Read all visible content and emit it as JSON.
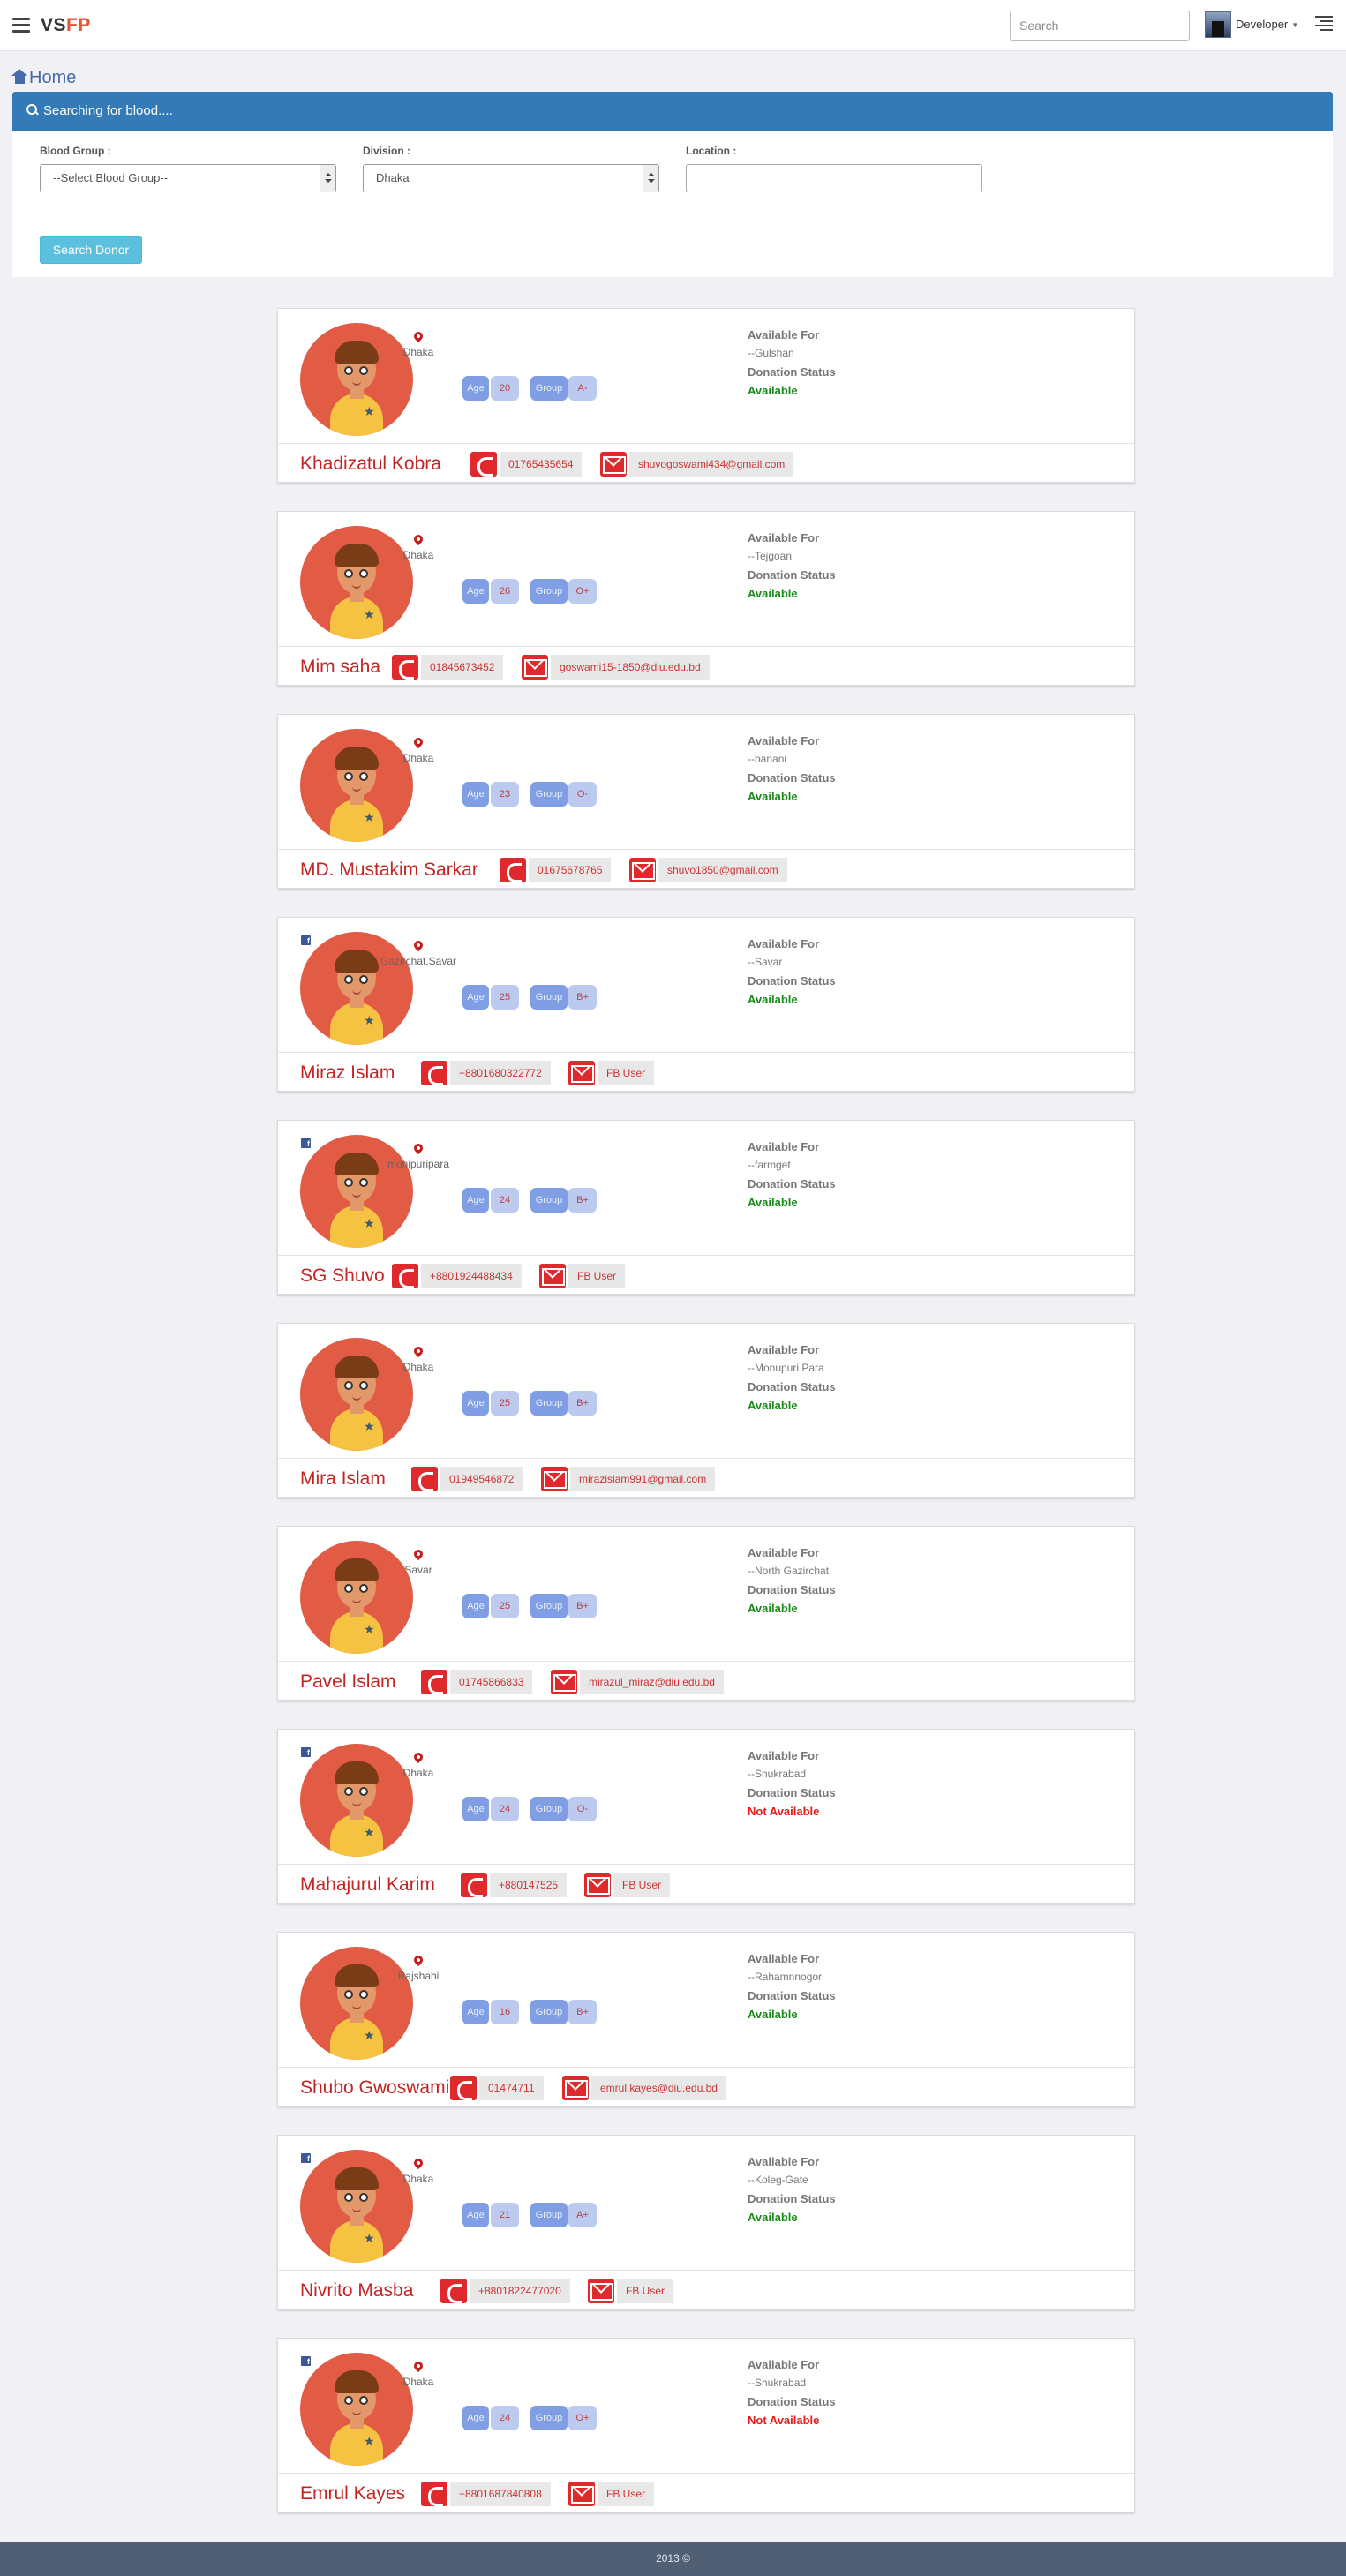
{
  "navbar": {
    "brand_part1": "VS",
    "brand_part2": "FP",
    "search_placeholder": "Search",
    "user_name": "Developer"
  },
  "breadcrumb": {
    "label": "Home"
  },
  "search_panel": {
    "heading": "Searching for blood....",
    "blood_group_label": "Blood Group :",
    "blood_group_value": "--Select Blood Group--",
    "division_label": "Division :",
    "division_value": "Dhaka",
    "location_label": "Location :",
    "location_value": "",
    "button_label": "Search Donor"
  },
  "labels": {
    "age": "Age",
    "group": "Group",
    "available_for": "Available For",
    "donation_status": "Donation Status"
  },
  "colors": {
    "available": "#1a8a1a",
    "not_available": "#e61b1b"
  },
  "donors": [
    {
      "name": "Khadizatul Kobra",
      "location": "Dhaka",
      "age": "20",
      "group": "A-",
      "available_for": "--Gulshan",
      "status": "Available",
      "phone": "01765435654",
      "email": "shuvogoswami434@gmail.com",
      "facebook": false
    },
    {
      "name": "Mim saha",
      "location": "Dhaka",
      "age": "26",
      "group": "O+",
      "available_for": "--Tejgoan",
      "status": "Available",
      "phone": "01845673452",
      "email": "goswami15-1850@diu.edu.bd",
      "facebook": false
    },
    {
      "name": "MD. Mustakim Sarkar",
      "location": "Dhaka",
      "age": "23",
      "group": "O-",
      "available_for": "--banani",
      "status": "Available",
      "phone": "01675678765",
      "email": "shuvo1850@gmail.com",
      "facebook": false
    },
    {
      "name": "Miraz Islam",
      "location": "Gazirchat,Savar",
      "age": "25",
      "group": "B+",
      "available_for": "--Savar",
      "status": "Available",
      "phone": "+8801680322772",
      "email": "FB User",
      "facebook": true
    },
    {
      "name": "SG Shuvo",
      "location": "monipuripara",
      "age": "24",
      "group": "B+",
      "available_for": "--farmget",
      "status": "Available",
      "phone": "+8801924488434",
      "email": "FB User",
      "facebook": true
    },
    {
      "name": "Mira Islam",
      "location": "Dhaka",
      "age": "25",
      "group": "B+",
      "available_for": "--Monupuri Para",
      "status": "Available",
      "phone": "01949546872",
      "email": "mirazislam991@gmail.com",
      "facebook": false
    },
    {
      "name": "Pavel Islam",
      "location": "Savar",
      "age": "25",
      "group": "B+",
      "available_for": "--North Gazirchat",
      "status": "Available",
      "phone": "01745866833",
      "email": "mirazul_miraz@diu.edu.bd",
      "facebook": false
    },
    {
      "name": "Mahajurul Karim",
      "location": "Dhaka",
      "age": "24",
      "group": "O-",
      "available_for": "--Shukrabad",
      "status": "Not Available",
      "phone": "+880147525",
      "email": "FB User",
      "facebook": true
    },
    {
      "name": "Shubo Gwoswami",
      "location": "Rajshahi",
      "age": "16",
      "group": "B+",
      "available_for": "--Rahamnnogor",
      "status": "Available",
      "phone": "01474711",
      "email": "emrul.kayes@diu.edu.bd",
      "facebook": false
    },
    {
      "name": "Nivrito Masba",
      "location": "Dhaka",
      "age": "21",
      "group": "A+",
      "available_for": "--Koleg-Gate",
      "status": "Available",
      "phone": "+8801822477020",
      "email": "FB User",
      "facebook": true
    },
    {
      "name": "Emrul Kayes",
      "location": "Dhaka",
      "age": "24",
      "group": "O+",
      "available_for": "--Shukrabad",
      "status": "Not Available",
      "phone": "+8801687840808",
      "email": "FB User",
      "facebook": true
    }
  ],
  "footer": {
    "text": "2013 ©"
  }
}
